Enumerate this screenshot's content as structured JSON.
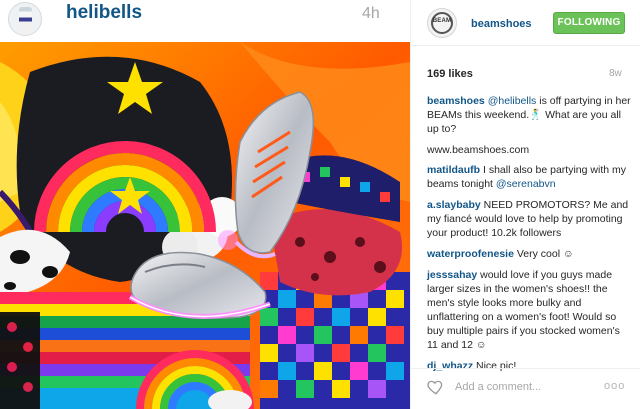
{
  "post": {
    "poster_username": "helibells",
    "time": "4h",
    "photo_alt": "photo"
  },
  "panel": {
    "username": "beamshoes",
    "logo_text": "BEAM",
    "follow_label": "FOLLOWING",
    "likes": "169 likes",
    "age": "8w",
    "comments": [
      {
        "user": "beamshoes",
        "mention": "@helibells",
        "text": " is off partying in her BEAMs this weekend.🕺 What are you all up to?"
      },
      {
        "user": "",
        "mention": "",
        "text": "www.beamshoes.com"
      },
      {
        "user": "matildaufb",
        "mention": "",
        "text": " I shall also be partying with my beams tonight ",
        "mention2": "@serenabvn"
      },
      {
        "user": "a.slaybaby",
        "mention": "",
        "text": " NEED PROMOTORS? Me and my fiancé would love to help by promoting your product! 10.2k followers"
      },
      {
        "user": "waterproofenesie",
        "mention": "",
        "text": " Very cool ☺"
      },
      {
        "user": "jesssahay",
        "mention": "",
        "text": " would love if you guys made larger sizes in the women's shoes!! the men's style looks more bulky and unflattering on a women's foot! Would so buy multiple pairs if you stocked women's 11 and 12 ☺"
      },
      {
        "user": "dj_whazz",
        "mention": "",
        "text": " Nice pic!"
      }
    ],
    "add_comment_placeholder": "Add a comment...",
    "more_label": "ooo"
  },
  "colors": {
    "link": "#125688",
    "follow_green": "#6bc259",
    "muted": "#a5a7aa"
  },
  "icons": {
    "heart": "heart-icon",
    "more": "more-options-icon"
  }
}
